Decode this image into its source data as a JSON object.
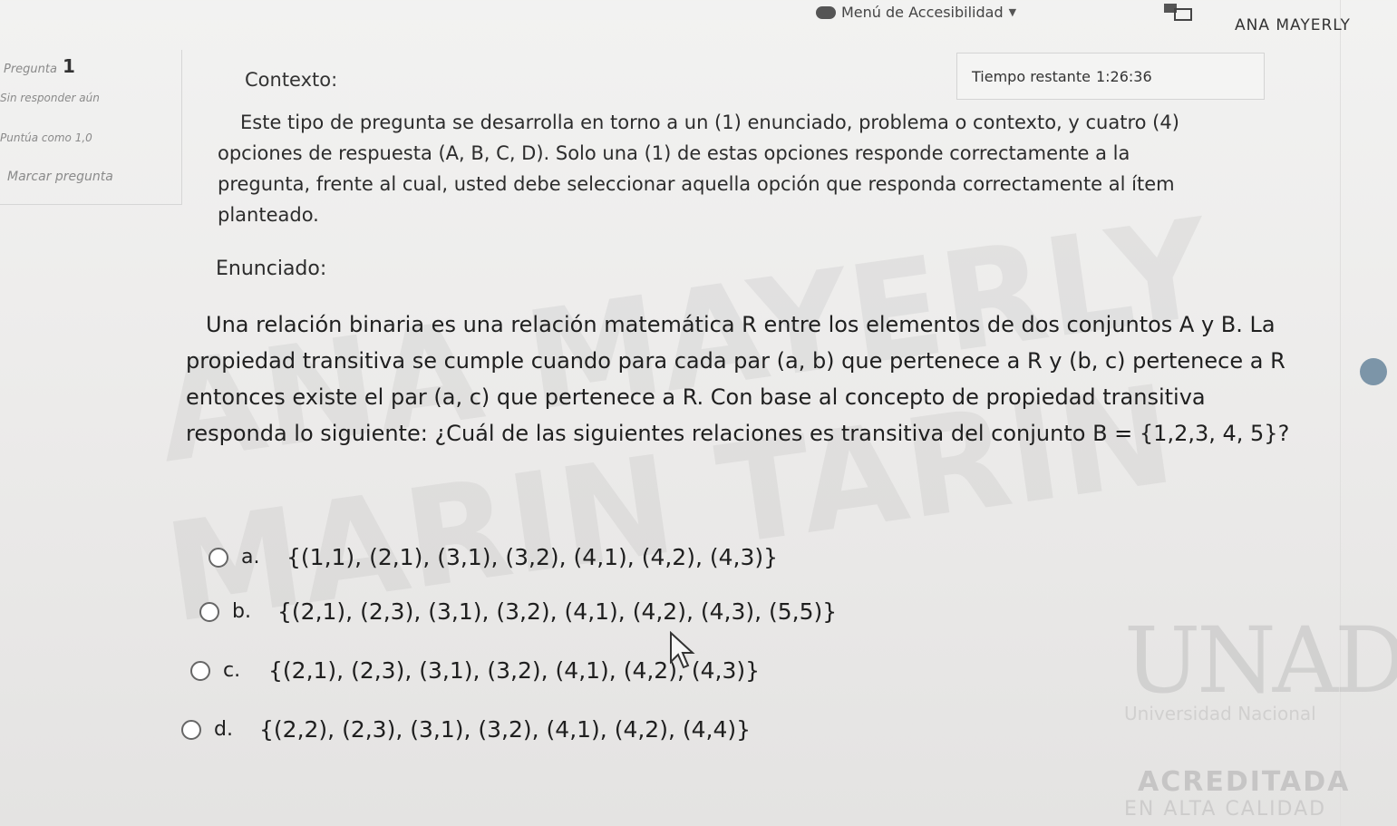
{
  "topbar": {
    "accessibility_menu": "Menú de Accesibilidad",
    "user_name": "ANA MAYERLY"
  },
  "question_info": {
    "label": "Pregunta",
    "number": "1",
    "status": "Sin responder aún",
    "score": "Puntúa como 1,0",
    "flag": "Marcar pregunta"
  },
  "timer": {
    "label": "Tiempo restante",
    "value": "1:26:36"
  },
  "context": {
    "label": "Contexto:",
    "text": "Este tipo de pregunta se desarrolla en torno a un (1) enunciado, problema o contexto, y cuatro (4) opciones de respuesta (A, B, C, D). Solo una (1) de estas opciones responde correctamente a la pregunta, frente al cual, usted debe seleccionar aquella opción que responda correctamente al ítem planteado."
  },
  "statement": {
    "label": "Enunciado:",
    "text": "Una relación binaria es una relación matemática R entre los elementos de dos conjuntos A y B. La propiedad transitiva se cumple cuando para cada par (a, b) que pertenece a R y (b, c) pertenece a R entonces existe el par (a, c) que pertenece a R. Con base al concepto de propiedad transitiva responda lo siguiente: ¿Cuál de las siguientes relaciones es transitiva del conjunto B = {1,2,3, 4, 5}?"
  },
  "options": [
    {
      "letter": "a.",
      "set": "{(1,1), (2,1), (3,1), (3,2), (4,1), (4,2), (4,3)}"
    },
    {
      "letter": "b.",
      "set": "{(2,1), (2,3), (3,1), (3,2), (4,1), (4,2), (4,3), (5,5)}"
    },
    {
      "letter": "c.",
      "set": "{(2,1), (2,3), (3,1), (3,2), (4,1), (4,2), (4,3)}"
    },
    {
      "letter": "d.",
      "set": "{(2,2), (2,3), (3,1), (3,2), (4,1), (4,2), (4,4)}"
    }
  ],
  "watermark": {
    "line1": "ANA MAYERLY",
    "line2": "MARIN TARIN"
  },
  "logo": {
    "name": "UNAD",
    "subtitle": "Universidad Nacional",
    "accreditation": "ACREDITADA",
    "accreditation_sub": "EN ALTA CALIDAD"
  }
}
